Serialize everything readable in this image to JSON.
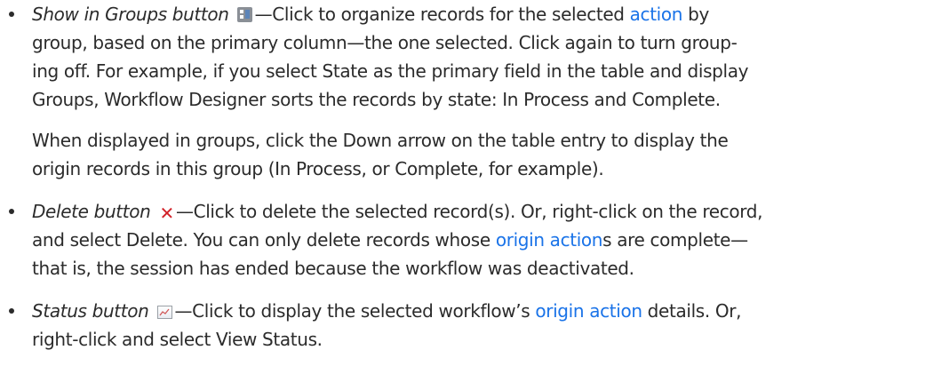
{
  "items": [
    {
      "term": "Show in Groups button",
      "icon": "show-in-groups-icon",
      "lines": [
        {
          "pre": "—Click to organize records for the selected ",
          "link": "action",
          "post": " by"
        },
        {
          "text": "group, based on the primary column—the one selected. Click again to turn group-"
        },
        {
          "text": "ing off. For example, if you select State as the primary field in the table and display"
        },
        {
          "text": "Groups, Workflow Designer sorts the records by state: In Process and Complete."
        }
      ],
      "followup": [
        "When displayed in groups, click the Down arrow on the table entry to display the",
        "origin records in this group (In Process, or Complete, for example)."
      ]
    },
    {
      "term": "Delete button",
      "icon": "delete-icon",
      "lines": [
        {
          "text": "—Click to delete the selected record(s). Or, right-click on the record,"
        },
        {
          "pre": "and select Delete. You can only delete records whose ",
          "link": "origin action",
          "post": "s are complete—"
        },
        {
          "text": "that is, the session has ended because the workflow was deactivated."
        }
      ]
    },
    {
      "term": "Status button",
      "icon": "status-icon",
      "lines": [
        {
          "pre": "—Click to display the selected workflow’s ",
          "link": "origin action",
          "post": " details. Or,"
        },
        {
          "text": "right-click and select View Status."
        }
      ]
    }
  ],
  "colors": {
    "text": "#2b2b2b",
    "link": "#1a73e8",
    "delete_icon": "#d2232a"
  }
}
